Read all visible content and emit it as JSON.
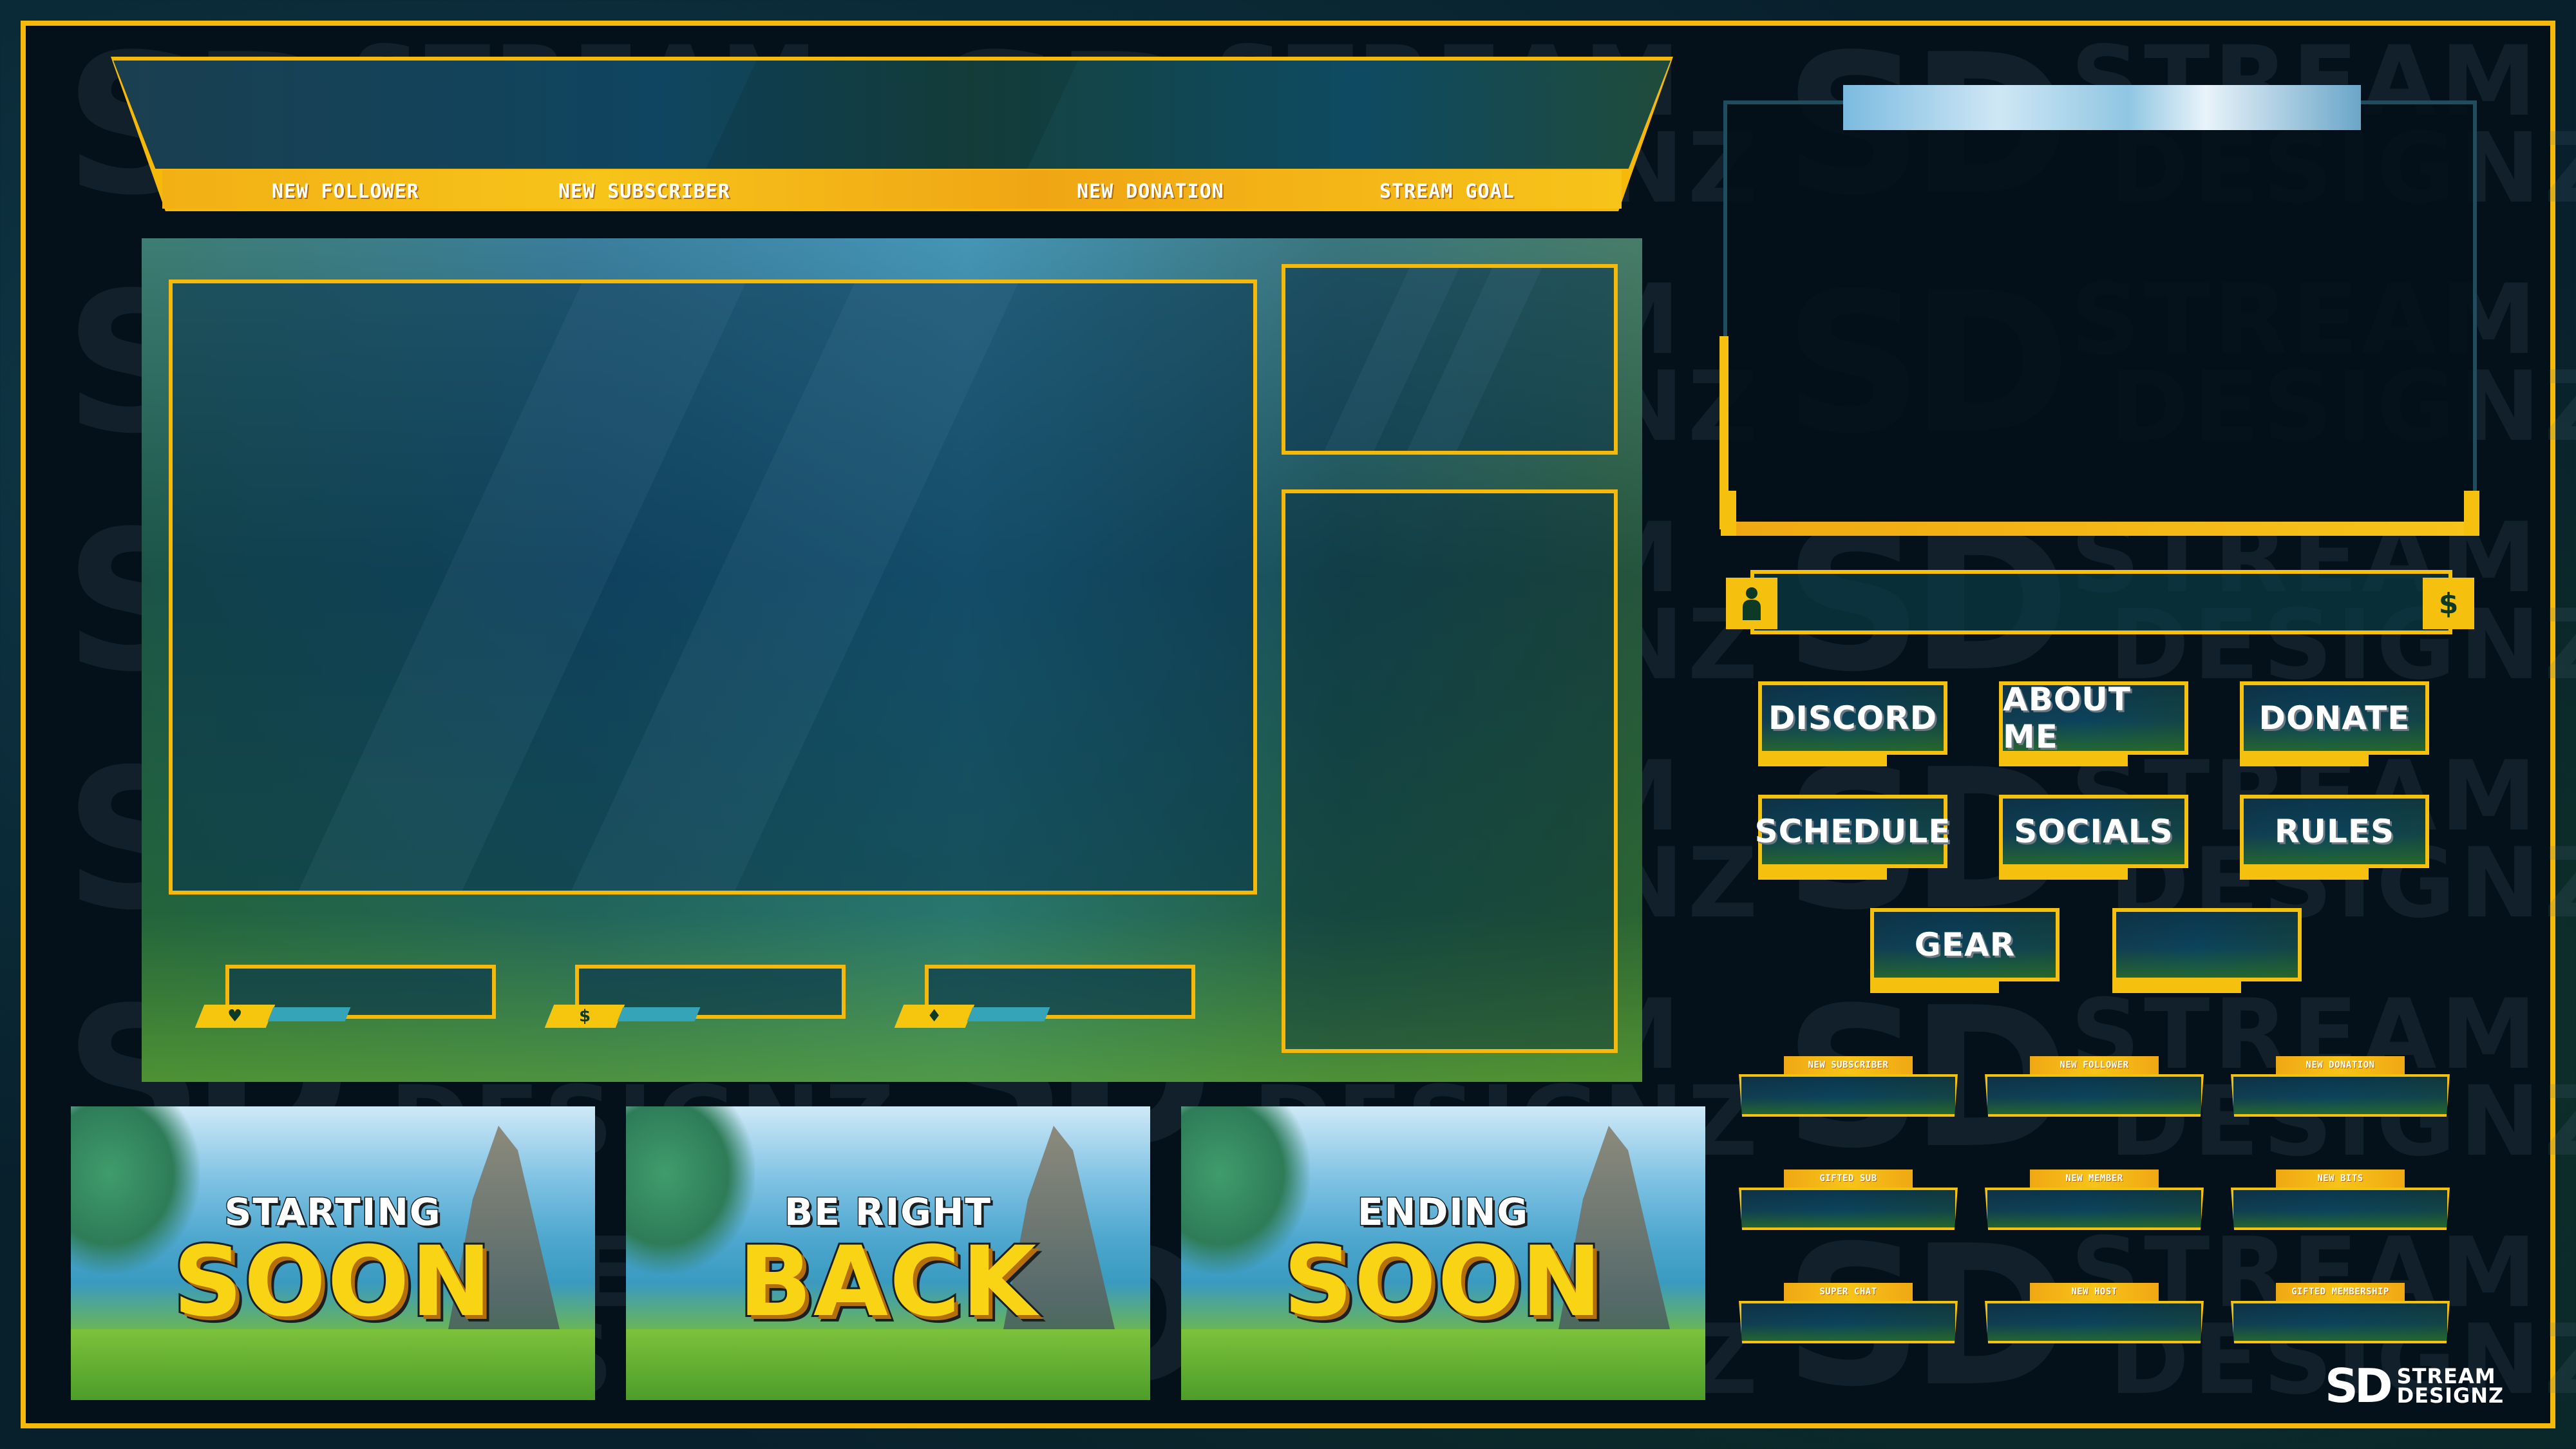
{
  "brand": {
    "logo_mark": "SD",
    "logo_line1": "STREAM",
    "logo_line2": "DESIGNZ",
    "watermark_line1": "STREAM",
    "watermark_line2": "DESIGNZ"
  },
  "colors": {
    "accent_yellow": "#f6b90a",
    "background_dark": "#04111a",
    "panel_text": "#ffffff",
    "info_tail_teal": "#35a3b8",
    "title_yellow": "#f8d414"
  },
  "alerts_banner": {
    "labels": [
      "NEW FOLLOWER",
      "NEW SUBSCRIBER",
      "NEW DONATION",
      "STREAM GOAL"
    ]
  },
  "info_bars": [
    {
      "icon": "heart-icon",
      "glyph": "♥"
    },
    {
      "icon": "dollar-icon",
      "glyph": "$"
    },
    {
      "icon": "diamond-icon",
      "glyph": "♦"
    }
  ],
  "donation_bar": {
    "left_icon": "user-icon",
    "left_glyph": "👤",
    "right_icon": "dollar-icon",
    "right_glyph": "$"
  },
  "panels": [
    {
      "label": "DISCORD"
    },
    {
      "label": "ABOUT ME"
    },
    {
      "label": "DONATE"
    },
    {
      "label": "SCHEDULE"
    },
    {
      "label": "SOCIALS"
    },
    {
      "label": "RULES"
    },
    {
      "label": "GEAR"
    },
    {
      "label": ""
    }
  ],
  "alert_boxes": [
    {
      "label": "NEW SUBSCRIBER"
    },
    {
      "label": "NEW FOLLOWER"
    },
    {
      "label": "NEW DONATION"
    },
    {
      "label": "GIFTED SUB"
    },
    {
      "label": "NEW MEMBER"
    },
    {
      "label": "NEW BITS"
    },
    {
      "label": "SUPER CHAT"
    },
    {
      "label": "NEW HOST"
    },
    {
      "label": "GIFTED MEMBERSHIP"
    }
  ],
  "screens": [
    {
      "line1": "STARTING",
      "line2": "SOON"
    },
    {
      "line1": "BE RIGHT",
      "line2": "BACK"
    },
    {
      "line1": "ENDING",
      "line2": "SOON"
    }
  ]
}
